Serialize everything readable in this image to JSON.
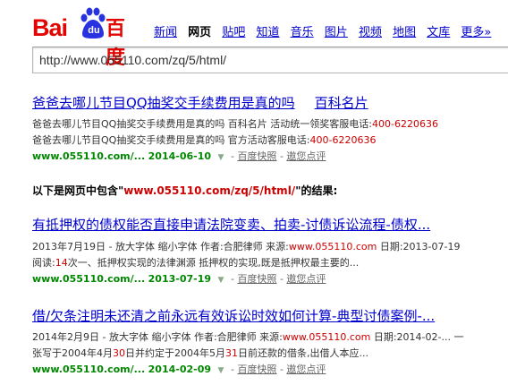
{
  "logo": {
    "bai": "Bai",
    "du": "du",
    "cn": "百度"
  },
  "nav": [
    "新闻",
    "网页",
    "贴吧",
    "知道",
    "音乐",
    "图片",
    "视频",
    "地图",
    "文库",
    "更多»"
  ],
  "search": {
    "value": "http://www.055110.com/zq/5/html/"
  },
  "results": [
    {
      "title": "爸爸去哪儿节目QQ抽奖交手续费用是真的吗",
      "title2": "百科名片",
      "lines": [
        {
          "text": "爸爸去哪儿节目QQ抽奖交手续费用是真的吗 百科名片 活动统一领奖客服电话:",
          "num": "400-6220636"
        },
        {
          "text": "爸爸去哪儿节目QQ抽奖交手续费用是真的吗 官方活动客服电话:",
          "num": "400-6220636"
        }
      ],
      "url": "www.055110.com/...",
      "date": "2014-06-10",
      "cache": "百度快照",
      "review": "遨您点评"
    },
    {
      "title": "有抵押权的债权能否直接申请法院变卖、拍卖-讨债诉讼流程-债权...",
      "line1": {
        "pre": "2013年7月19日 - 放大字体 缩小字体 作者:合肥律师 来源:",
        "site": "www.055110.com",
        "post": " 日期:2013-07-19"
      },
      "line2": {
        "pre": "阅读:",
        "num": "14",
        "post": "次一、抵押权实现的法律渊源 抵押权的实现,既是抵押权最主要的..."
      },
      "url": "www.055110.com/...",
      "date": "2013-07-19",
      "cache": "百度快照",
      "review": "遨您点评"
    },
    {
      "title": "借/欠条注明未还清之前永远有效诉讼时效如何计算-典型讨债案例-...",
      "line1": {
        "pre": "2014年2月9日 - 放大字体 缩小字体 作者:合肥律师 来源:",
        "site": "www.055110.com",
        "post": " 日期:2014-02-... 一"
      },
      "line2": {
        "pre": "张写于2004年4月",
        "n1": "30",
        "mid": "日并约定于2004年5月",
        "n2": "31",
        "post": "日前还款的借条,出借人本应..."
      },
      "url": "www.055110.com/...",
      "date": "2014-02-09",
      "cache": "百度快照",
      "review": "遨您点评"
    }
  ],
  "notice": {
    "pre": "以下是网页中包含\"",
    "url": "www.055110.com/zq/5/html/",
    "post": "\"的结果:"
  },
  "colors": {
    "brand_red": "#e10601",
    "brand_blue": "#2932e1",
    "link": "#0000cc",
    "url_green": "#008000"
  }
}
